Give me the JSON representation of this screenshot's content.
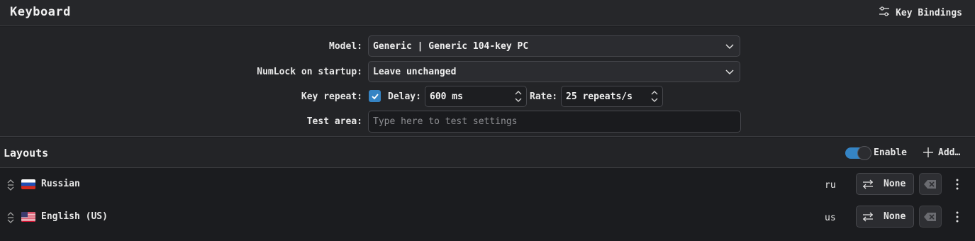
{
  "header": {
    "title": "Keyboard",
    "key_bindings_label": "Key Bindings"
  },
  "settings": {
    "model": {
      "label": "Model:",
      "value": "Generic | Generic 104-key PC"
    },
    "numlock": {
      "label": "NumLock on startup:",
      "value": "Leave unchanged"
    },
    "key_repeat": {
      "label": "Key repeat:",
      "enabled": true,
      "delay_label": "Delay:",
      "delay_value": "600 ms",
      "rate_label": "Rate:",
      "rate_value": "25 repeats/s"
    },
    "test_area": {
      "label": "Test area:",
      "placeholder": "Type here to test settings"
    }
  },
  "layouts": {
    "title": "Layouts",
    "enable_label": "Enable",
    "enabled": true,
    "add_label": "Add…",
    "items": [
      {
        "name": "Russian",
        "code": "ru",
        "flag": "russia-flag",
        "options_label": "None"
      },
      {
        "name": "English (US)",
        "code": "us",
        "flag": "us-flag",
        "options_label": "None"
      }
    ]
  },
  "colors": {
    "accent": "#3584c4",
    "background": "#1b1c1f",
    "panel": "#232427"
  }
}
